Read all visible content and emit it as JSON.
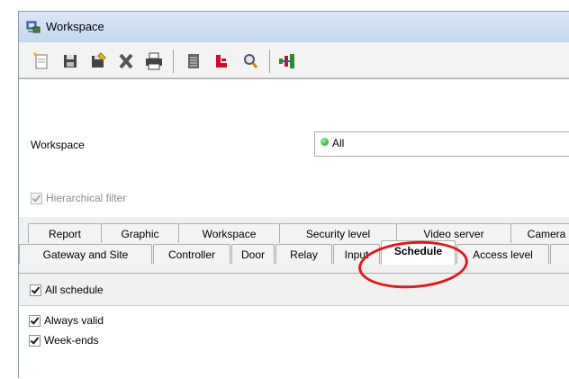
{
  "window": {
    "title": "Workspace"
  },
  "toolbar": {
    "buttons": [
      {
        "icon": "new-icon"
      },
      {
        "icon": "save-icon"
      },
      {
        "icon": "save-as-icon"
      },
      {
        "icon": "delete-icon"
      },
      {
        "icon": "print-icon"
      },
      {
        "icon": "list-icon"
      },
      {
        "icon": "link-icon"
      },
      {
        "icon": "search-icon"
      },
      {
        "icon": "network-icon"
      }
    ]
  },
  "filter": {
    "workspace_label": "Workspace",
    "workspace_value": "All",
    "hierarchical_label": "Hierarchical filter"
  },
  "tabs": {
    "row1": [
      "Report",
      "Graphic",
      "Workspace",
      "Security level",
      "Video server",
      "Camera"
    ],
    "row2": [
      "Gateway and Site",
      "Controller",
      "Door",
      "Relay",
      "Input",
      "Schedule",
      "Access level"
    ],
    "active": "Schedule"
  },
  "schedule": {
    "all_label": "All schedule",
    "items": [
      "Always valid",
      "Week-ends"
    ]
  },
  "colors": {
    "annotation": "#e01a1a",
    "accent": "#1a9a1a"
  }
}
